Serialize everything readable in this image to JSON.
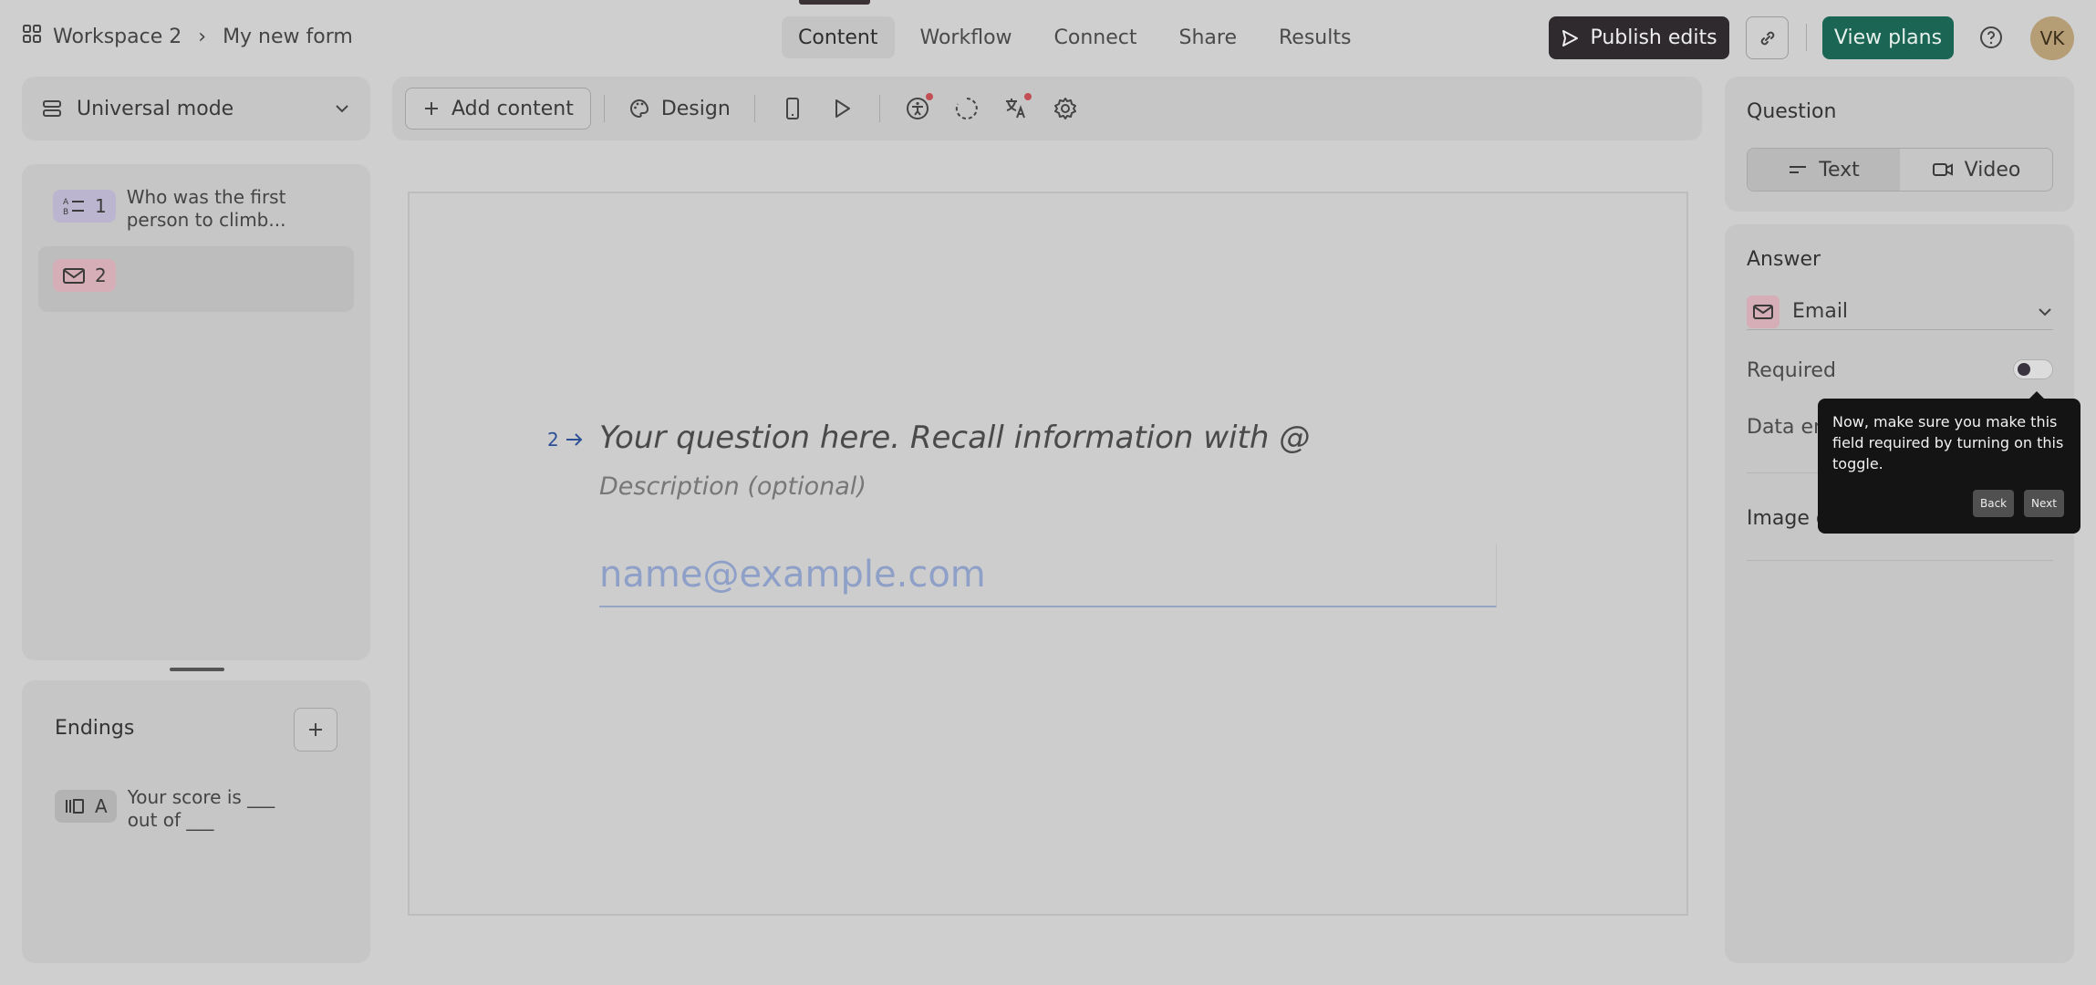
{
  "breadcrumb": {
    "workspace": "Workspace 2",
    "form": "My new form"
  },
  "tabs": [
    "Content",
    "Workflow",
    "Connect",
    "Share",
    "Results"
  ],
  "header": {
    "publish": "Publish edits",
    "view_plans": "View plans",
    "avatar": "VK"
  },
  "left": {
    "mode": "Universal mode",
    "questions": [
      {
        "num": "1",
        "text": "Who was the first person to climb..."
      },
      {
        "num": "2",
        "text": ""
      }
    ],
    "endings_title": "Endings",
    "endings": [
      {
        "letter": "A",
        "text": "Your score is ___ out of ___"
      }
    ]
  },
  "toolbar": {
    "add_content": "Add content",
    "design": "Design"
  },
  "canvas": {
    "qnum": "2",
    "question_placeholder": "Your question here. Recall information with @",
    "description_placeholder": "Description (optional)",
    "email_placeholder": "name@example.com"
  },
  "right": {
    "question_label": "Question",
    "text_btn": "Text",
    "video_btn": "Video",
    "answer_label": "Answer",
    "answer_type": "Email",
    "required_label": "Required",
    "data_label": "Data en",
    "image_label": "Image o"
  },
  "tooltip": {
    "text": "Now, make sure you make this field required by turning on this toggle.",
    "back": "Back",
    "next": "Next"
  }
}
